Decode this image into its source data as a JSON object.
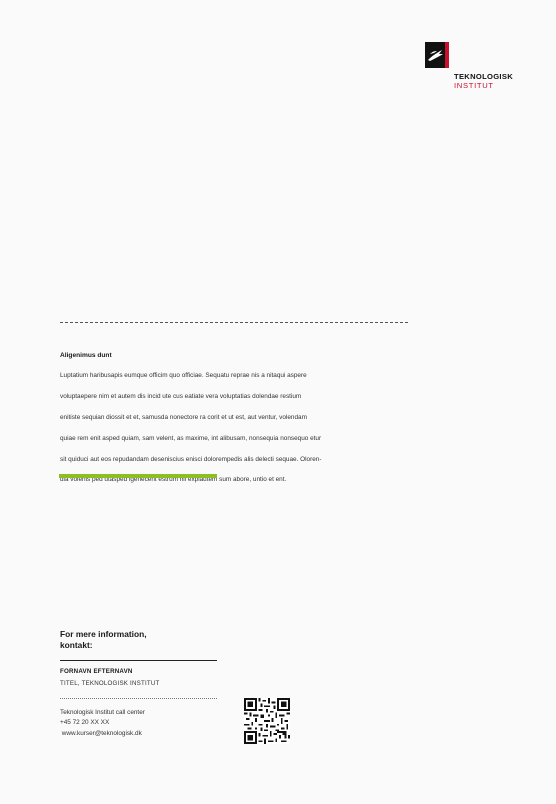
{
  "logo": {
    "name": "TEKNOLOGISK",
    "sub": "INSTITUT",
    "mark_icon": "teknologisk-bird-icon",
    "colors": {
      "mark": "#111111",
      "accent": "#c8102e"
    }
  },
  "section": {
    "heading": "Aligenimus dunt",
    "lines": [
      "Luptatium haribusapis eumque officim quo officiae. Sequatu reprae nis a nitaqui aspere",
      "voluptaepere nim et autem dis incid ute cus eatiate vera voluptatias dolendae restium",
      "enitiste sequian diossit et et, samusda nonectore ra corit et ut est, aut ventur, volendam",
      "quiae rem enit asped quiam, sam velent, as maxime, int alibusam, nonsequia nonsequo etur",
      "sit quiduci aut eos repudandam deseniscius enisci dolorempedis alis delecti sequae. Oloren-",
      "dia volenis ped utasped igenecerit estrum hil explautem sum abore, untio et ent."
    ]
  },
  "accent_color": "#8dbe23",
  "contact": {
    "heading": "For mere information,\nkontakt:",
    "name": "FORNAVN EFTERNAVN",
    "title": "TITEL, TEKNOLOGISK INSTITUT",
    "callcenter": "Teknologisk Institut call center",
    "phone": "+45 72 20 XX XX",
    "email": " www.kurser@teknologisk.dk",
    "qr_icon": "qr-code-icon"
  }
}
